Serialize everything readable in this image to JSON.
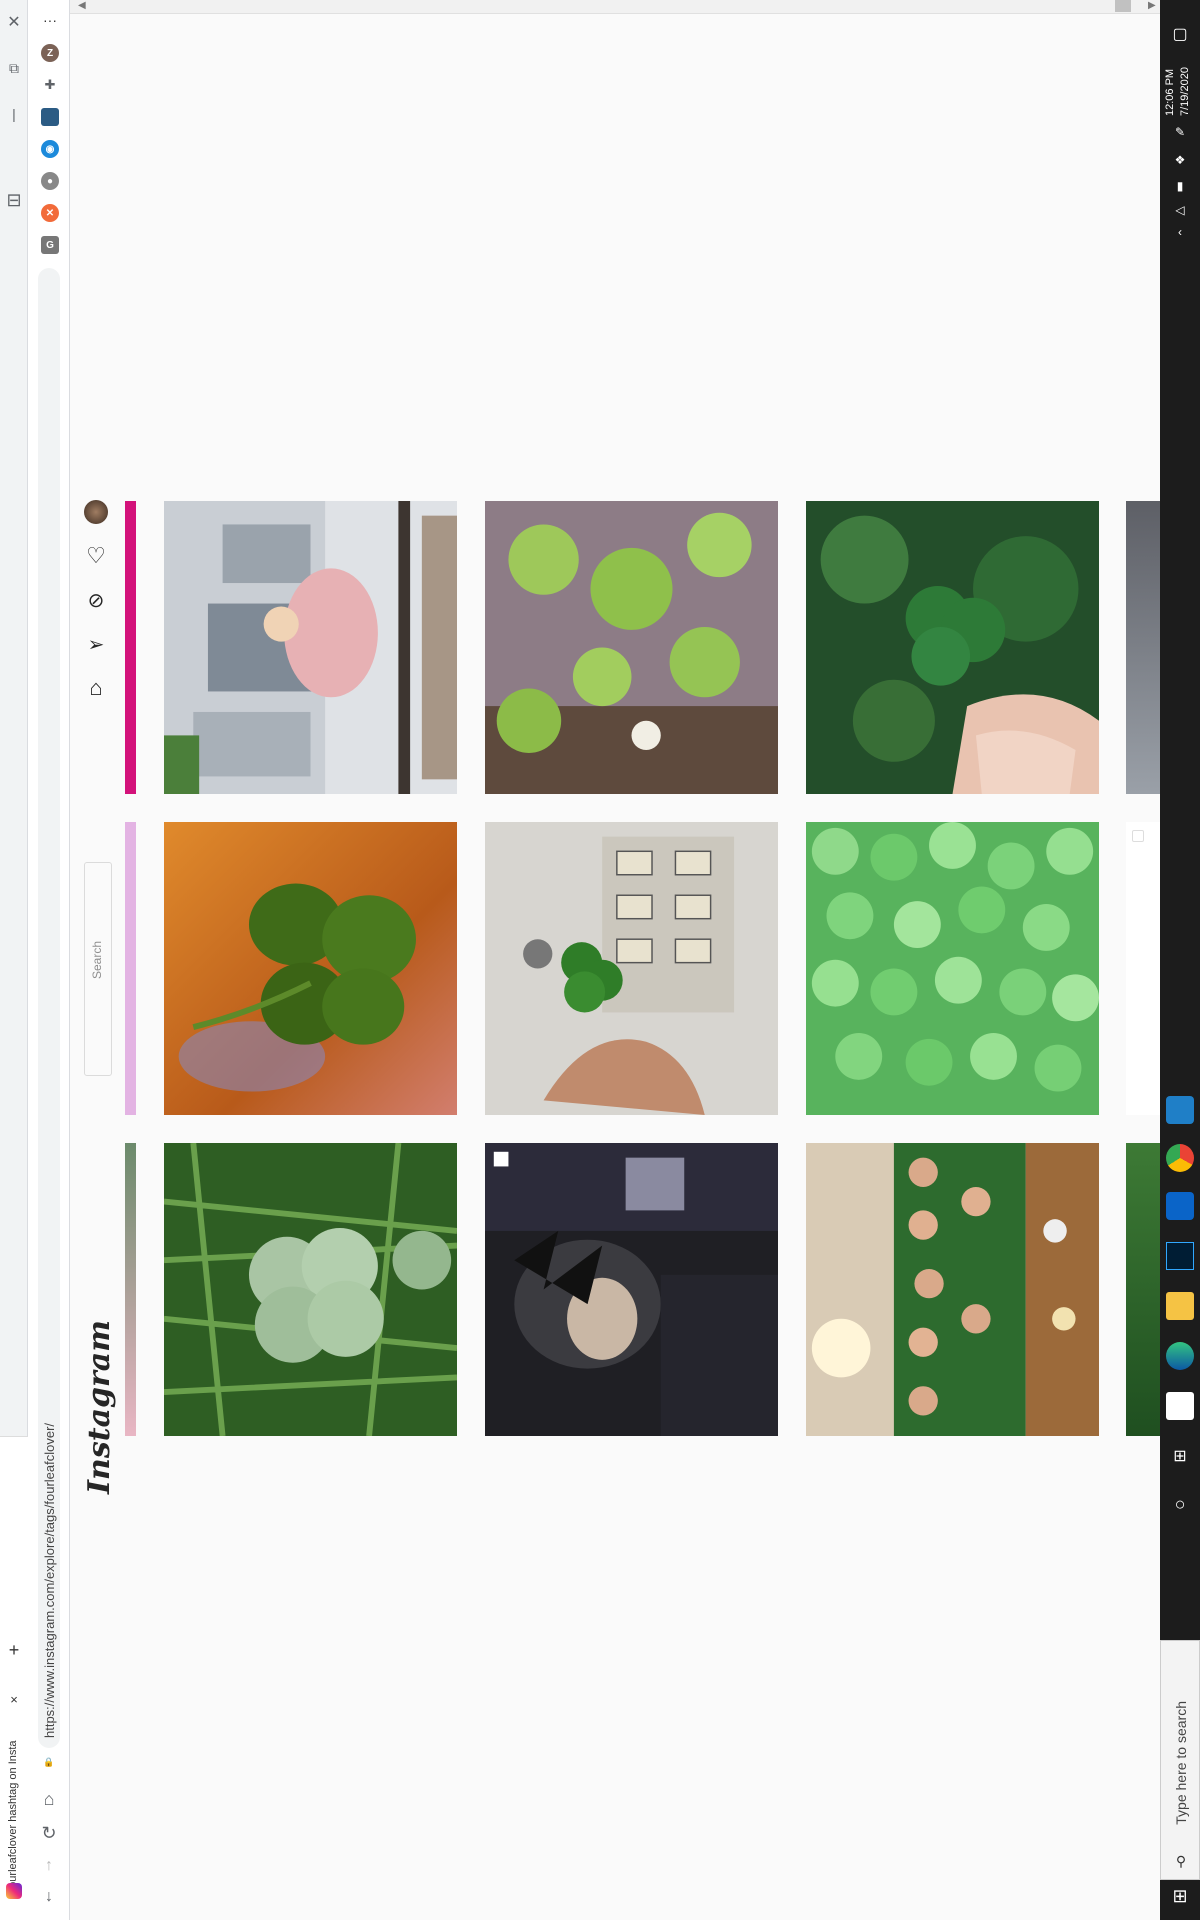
{
  "browser": {
    "tab_title": "#fourleafclover hashtag on Insta",
    "url": "https://www.instagram.com/explore/tags/fourleafclover/",
    "close_tab": "×",
    "new_tab": "+",
    "menu": "···",
    "profile_initial": "Z"
  },
  "instagram": {
    "logo": "Instagram",
    "search_placeholder": "Search"
  },
  "taskbar": {
    "time": "12:06 PM",
    "date": "7/19/2020",
    "search_placeholder": "Type here to search"
  },
  "grid": {
    "rows": [
      [
        "photo-woman-pink-dress-city",
        "photo-clovers-in-water",
        "photo-four-leaf-clover-held"
      ],
      [
        "photo-four-leaf-clover-wood",
        "photo-clover-hand-building",
        "photo-clover-field"
      ],
      [
        "photo-clover-in-grass",
        "photo-anime-character",
        "photo-group-party-green"
      ]
    ]
  },
  "colors": {
    "ig_accent": "#d3127a",
    "taskbar": "#1c1c1c",
    "chrome_bg": "#f1f3f4"
  }
}
